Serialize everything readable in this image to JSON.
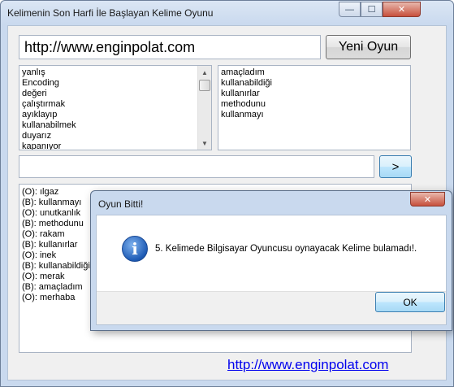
{
  "window": {
    "title": "Kelimenin Son Harfi İle Başlayan Kelime Oyunu",
    "minimize_glyph": "—",
    "maximize_glyph": "☐",
    "close_glyph": "✕"
  },
  "url_field": {
    "value": "http://www.enginpolat.com"
  },
  "new_game_button": {
    "label": "Yeni Oyun"
  },
  "left_list": {
    "items": [
      "yanlış",
      "Encoding",
      "değeri",
      "çalıştırmak",
      "ayıklayıp",
      "kullanabilmek",
      "duyarız",
      "kapanıyor"
    ]
  },
  "right_list": {
    "items": [
      "amaçladım",
      "kullanabildiği",
      "kullanırlar",
      "methodunu",
      "kullanmayı"
    ]
  },
  "word_input": {
    "value": ""
  },
  "submit_button": {
    "label": ">"
  },
  "moves_list": {
    "items": [
      "(O): ılgaz",
      "(B): kullanmayı",
      "(O): unutkanlık",
      "(B): methodunu",
      "(O): rakam",
      "(B): kullanırlar",
      "(O): inek",
      "(B): kullanabildiği",
      "(O): merak",
      "(B): amaçladım",
      "(O): merhaba"
    ]
  },
  "footer_link": {
    "text": "http://www.enginpolat.com"
  },
  "dialog": {
    "title": "Oyun Bitti!",
    "close_glyph": "✕",
    "icon": "info-icon",
    "icon_glyph": "i",
    "message": "5. Kelimede Bilgisayar Oyuncusu oynayacak Kelime bulamadı!.",
    "ok_label": "OK"
  }
}
